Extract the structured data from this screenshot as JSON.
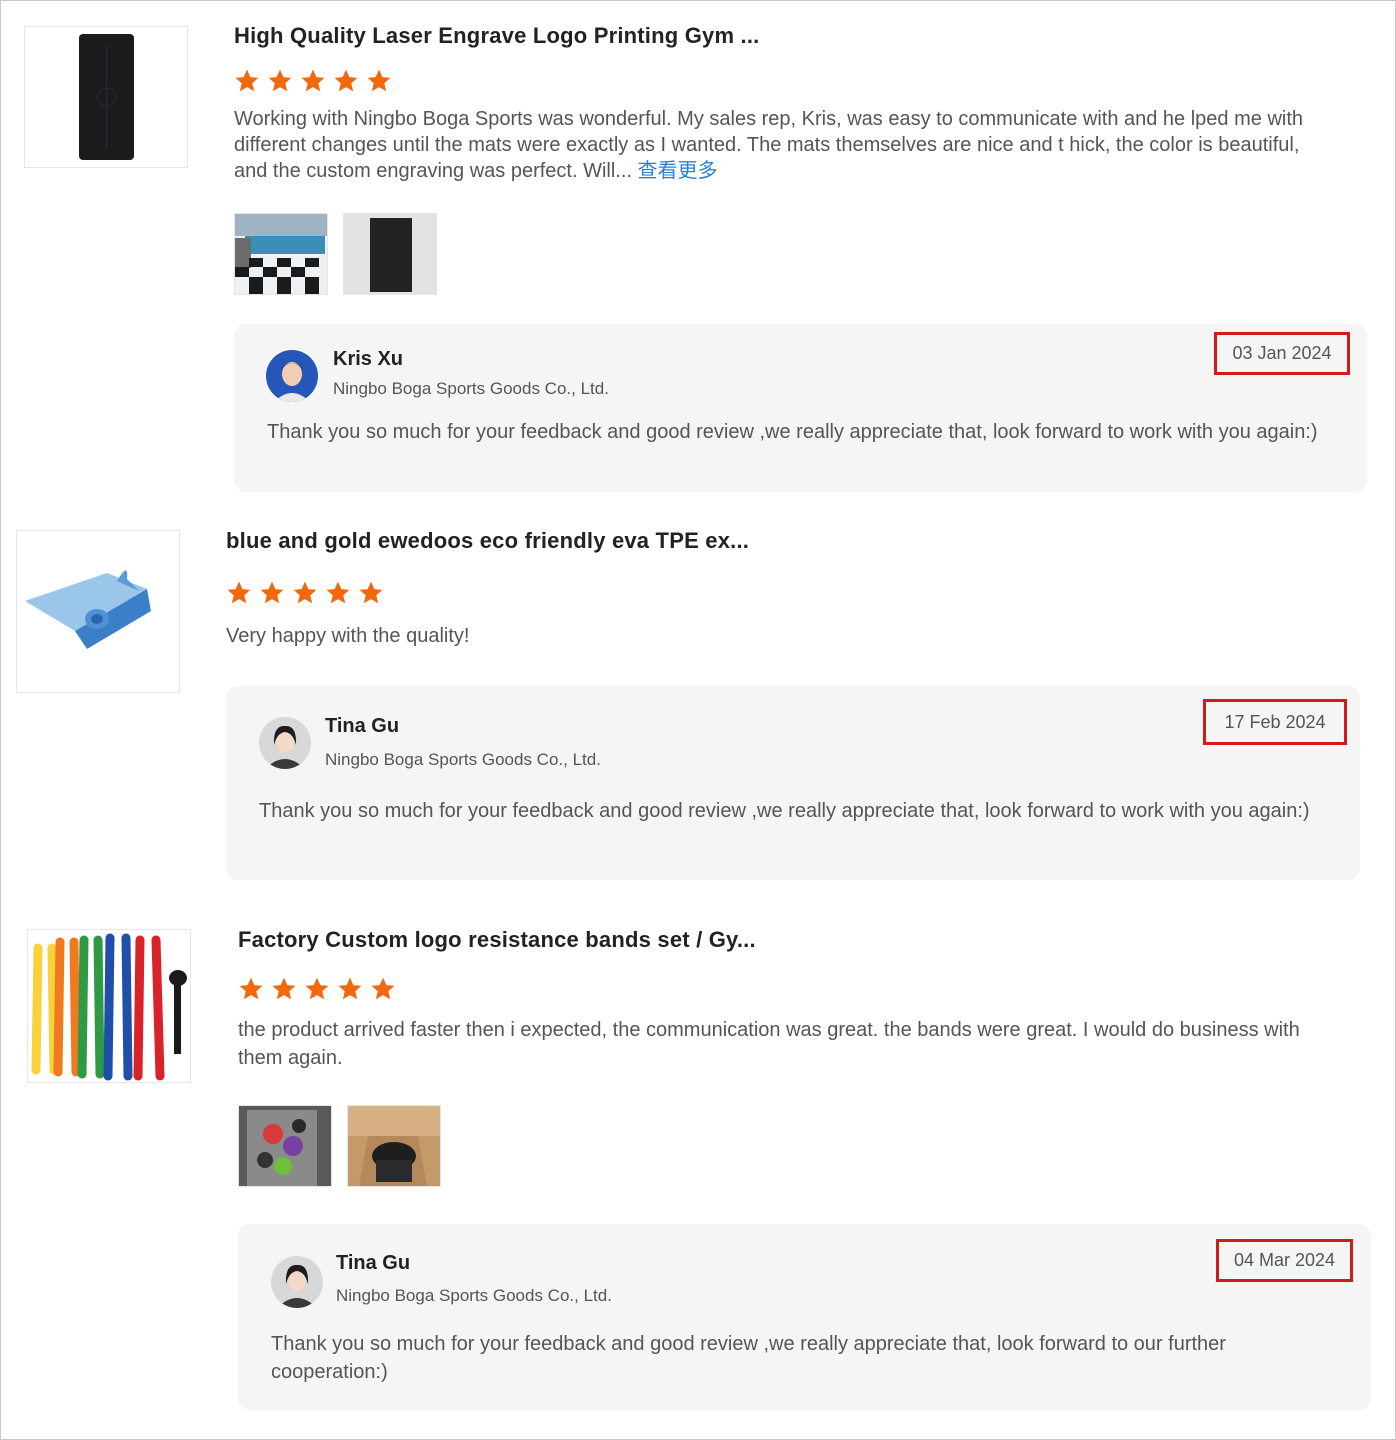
{
  "colors": {
    "star": "#f2680d",
    "link": "#2f7fd1",
    "date_highlight": "#d21a1a",
    "reply_bg": "#f5f5f5"
  },
  "reviews": [
    {
      "product_title": "High Quality Laser Engrave Logo Printing Gym ...",
      "rating": 5,
      "body": "Working with Ningbo Boga Sports was wonderful. My sales rep, Kris, was easy to communicate with and he lped me with different changes until the mats were exactly as I wanted. The mats themselves are nice and t hick, the color is beautiful, and the custom engraving was perfect. Will...",
      "more_label": "查看更多",
      "reply": {
        "name": "Kris Xu",
        "company": "Ningbo Boga Sports Goods Co., Ltd.",
        "date": "03 Jan 2024",
        "text": "Thank you so much for your feedback and good review ,we really appreciate that, look forward to work with you again:)"
      }
    },
    {
      "product_title": "blue and gold ewedoos eco friendly eva TPE ex...",
      "rating": 5,
      "body": "Very happy with the quality!",
      "reply": {
        "name": "Tina Gu",
        "company": "Ningbo Boga Sports Goods Co., Ltd.",
        "date": "17 Feb 2024",
        "text": "Thank you so much for your feedback and good review ,we really appreciate that, look forward to work with you again:)"
      }
    },
    {
      "product_title": "Factory Custom logo resistance bands set / Gy...",
      "rating": 5,
      "body": "the product arrived faster then i expected, the communication was great. the bands were great. I would do business with them again.",
      "reply": {
        "name": "Tina Gu",
        "company": "Ningbo Boga Sports Goods Co., Ltd.",
        "date": "04 Mar 2024",
        "text": "Thank you so much for your feedback and good review ,we really appreciate that, look forward to our further cooperation:)"
      }
    }
  ]
}
